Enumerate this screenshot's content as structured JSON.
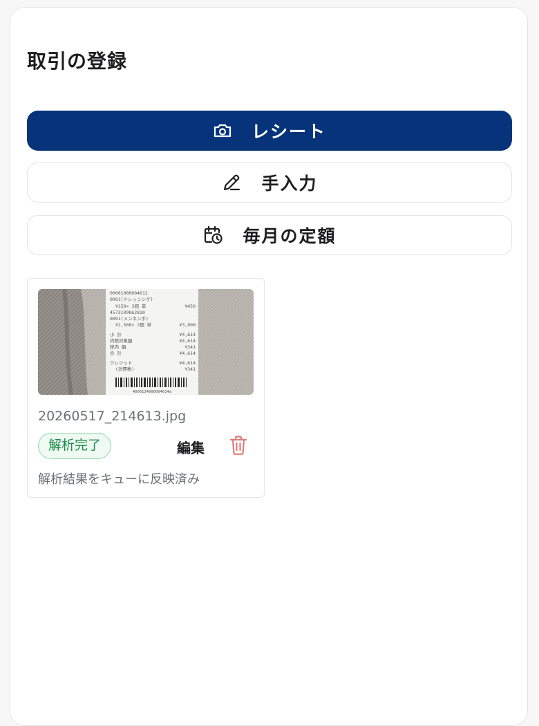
{
  "page": {
    "title": "取引の登録"
  },
  "actions": {
    "receipt": {
      "label": "レシート",
      "icon": "camera-icon"
    },
    "manual": {
      "label": "手入力",
      "icon": "pencil-icon"
    },
    "monthly": {
      "label": "毎月の定額",
      "icon": "calendar-clock-icon"
    }
  },
  "upload": {
    "filename": "20260517_214613.jpg",
    "status_badge": "解析完了",
    "edit_label": "編集",
    "delete_icon": "trash-icon",
    "status_note": "解析結果をキューに反映済み",
    "receipt_lines": [
      "00001000004612",
      "0001(ドレッシング)",
      "¥150× 3個 単",
      "4573109862810",
      "0001(メンネンボ)",
      "¥1,500× 2個 単",
      "小 計",
      "内税対象額",
      "税内 額",
      "合 計",
      "クレジット",
      "(消費税)"
    ],
    "receipt_amounts": [
      "¥450",
      "¥3,000",
      "¥4,614",
      "¥4,614",
      "¥341",
      "¥4,614",
      "¥4,614",
      "¥341"
    ],
    "receipt_barcode_number": "4000134900004614a"
  },
  "colors": {
    "primary": "#06337a",
    "success_text": "#1f8a4c",
    "success_border": "#8fd6a8",
    "success_bg": "#eefaf2",
    "danger": "#e07a7a",
    "muted_text": "#6b6f75"
  }
}
